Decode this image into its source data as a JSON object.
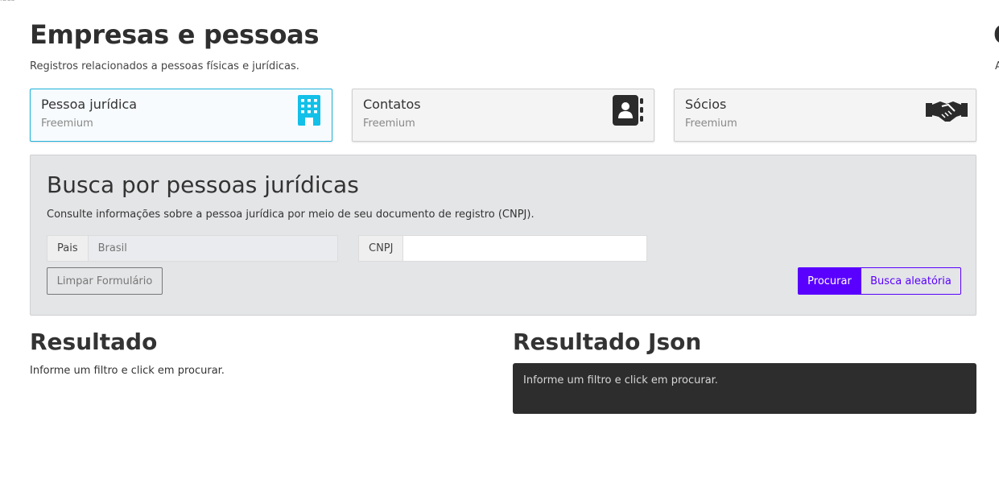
{
  "header": {
    "crumb": "ides",
    "title": "Empresas e pessoas",
    "subtitle": "Registros relacionados a pessoas físicas e jurídicas.",
    "edge_letter": "C",
    "edge_small": "A"
  },
  "cards": [
    {
      "title": "Pessoa jurídica",
      "subtitle": "Freemium",
      "icon": "building-icon",
      "active": true
    },
    {
      "title": "Contatos",
      "subtitle": "Freemium",
      "icon": "address-book-icon",
      "active": false
    },
    {
      "title": "Sócios",
      "subtitle": "Freemium",
      "icon": "handshake-icon",
      "active": false
    }
  ],
  "search": {
    "title": "Busca por pessoas jurídicas",
    "description": "Consulte informações sobre a pessoa jurídica por meio de seu documento de registro (CNPJ).",
    "country_label": "Pais",
    "country_placeholder": "Brasil",
    "cnpj_label": "CNPJ",
    "cnpj_value": "",
    "clear_label": "Limpar Formulário",
    "search_label": "Procurar",
    "random_label": "Busca aleatória"
  },
  "result": {
    "title": "Resultado",
    "text": "Informe um filtro e click em procurar."
  },
  "json_result": {
    "title": "Resultado Json",
    "text": "Informe um filtro e click em procurar."
  },
  "colors": {
    "accent": "#5a00ff",
    "active_card_border": "#1fb3dd",
    "building_icon": "#12c0e8",
    "dark_icon": "#2b2b2b",
    "json_bg": "#2d2d2d"
  }
}
